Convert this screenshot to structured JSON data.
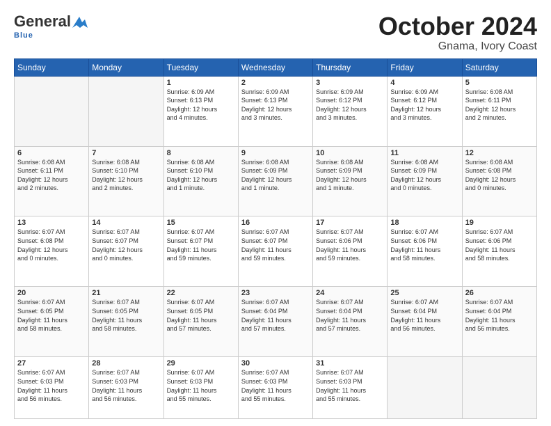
{
  "header": {
    "logo_line1": "General",
    "logo_line2": "Blue",
    "title": "October 2024",
    "subtitle": "Gnama, Ivory Coast"
  },
  "weekdays": [
    "Sunday",
    "Monday",
    "Tuesday",
    "Wednesday",
    "Thursday",
    "Friday",
    "Saturday"
  ],
  "weeks": [
    [
      {
        "day": "",
        "info": ""
      },
      {
        "day": "",
        "info": ""
      },
      {
        "day": "1",
        "info": "Sunrise: 6:09 AM\nSunset: 6:13 PM\nDaylight: 12 hours\nand 4 minutes."
      },
      {
        "day": "2",
        "info": "Sunrise: 6:09 AM\nSunset: 6:13 PM\nDaylight: 12 hours\nand 3 minutes."
      },
      {
        "day": "3",
        "info": "Sunrise: 6:09 AM\nSunset: 6:12 PM\nDaylight: 12 hours\nand 3 minutes."
      },
      {
        "day": "4",
        "info": "Sunrise: 6:09 AM\nSunset: 6:12 PM\nDaylight: 12 hours\nand 3 minutes."
      },
      {
        "day": "5",
        "info": "Sunrise: 6:08 AM\nSunset: 6:11 PM\nDaylight: 12 hours\nand 2 minutes."
      }
    ],
    [
      {
        "day": "6",
        "info": "Sunrise: 6:08 AM\nSunset: 6:11 PM\nDaylight: 12 hours\nand 2 minutes."
      },
      {
        "day": "7",
        "info": "Sunrise: 6:08 AM\nSunset: 6:10 PM\nDaylight: 12 hours\nand 2 minutes."
      },
      {
        "day": "8",
        "info": "Sunrise: 6:08 AM\nSunset: 6:10 PM\nDaylight: 12 hours\nand 1 minute."
      },
      {
        "day": "9",
        "info": "Sunrise: 6:08 AM\nSunset: 6:09 PM\nDaylight: 12 hours\nand 1 minute."
      },
      {
        "day": "10",
        "info": "Sunrise: 6:08 AM\nSunset: 6:09 PM\nDaylight: 12 hours\nand 1 minute."
      },
      {
        "day": "11",
        "info": "Sunrise: 6:08 AM\nSunset: 6:09 PM\nDaylight: 12 hours\nand 0 minutes."
      },
      {
        "day": "12",
        "info": "Sunrise: 6:08 AM\nSunset: 6:08 PM\nDaylight: 12 hours\nand 0 minutes."
      }
    ],
    [
      {
        "day": "13",
        "info": "Sunrise: 6:07 AM\nSunset: 6:08 PM\nDaylight: 12 hours\nand 0 minutes."
      },
      {
        "day": "14",
        "info": "Sunrise: 6:07 AM\nSunset: 6:07 PM\nDaylight: 12 hours\nand 0 minutes."
      },
      {
        "day": "15",
        "info": "Sunrise: 6:07 AM\nSunset: 6:07 PM\nDaylight: 11 hours\nand 59 minutes."
      },
      {
        "day": "16",
        "info": "Sunrise: 6:07 AM\nSunset: 6:07 PM\nDaylight: 11 hours\nand 59 minutes."
      },
      {
        "day": "17",
        "info": "Sunrise: 6:07 AM\nSunset: 6:06 PM\nDaylight: 11 hours\nand 59 minutes."
      },
      {
        "day": "18",
        "info": "Sunrise: 6:07 AM\nSunset: 6:06 PM\nDaylight: 11 hours\nand 58 minutes."
      },
      {
        "day": "19",
        "info": "Sunrise: 6:07 AM\nSunset: 6:06 PM\nDaylight: 11 hours\nand 58 minutes."
      }
    ],
    [
      {
        "day": "20",
        "info": "Sunrise: 6:07 AM\nSunset: 6:05 PM\nDaylight: 11 hours\nand 58 minutes."
      },
      {
        "day": "21",
        "info": "Sunrise: 6:07 AM\nSunset: 6:05 PM\nDaylight: 11 hours\nand 58 minutes."
      },
      {
        "day": "22",
        "info": "Sunrise: 6:07 AM\nSunset: 6:05 PM\nDaylight: 11 hours\nand 57 minutes."
      },
      {
        "day": "23",
        "info": "Sunrise: 6:07 AM\nSunset: 6:04 PM\nDaylight: 11 hours\nand 57 minutes."
      },
      {
        "day": "24",
        "info": "Sunrise: 6:07 AM\nSunset: 6:04 PM\nDaylight: 11 hours\nand 57 minutes."
      },
      {
        "day": "25",
        "info": "Sunrise: 6:07 AM\nSunset: 6:04 PM\nDaylight: 11 hours\nand 56 minutes."
      },
      {
        "day": "26",
        "info": "Sunrise: 6:07 AM\nSunset: 6:04 PM\nDaylight: 11 hours\nand 56 minutes."
      }
    ],
    [
      {
        "day": "27",
        "info": "Sunrise: 6:07 AM\nSunset: 6:03 PM\nDaylight: 11 hours\nand 56 minutes."
      },
      {
        "day": "28",
        "info": "Sunrise: 6:07 AM\nSunset: 6:03 PM\nDaylight: 11 hours\nand 56 minutes."
      },
      {
        "day": "29",
        "info": "Sunrise: 6:07 AM\nSunset: 6:03 PM\nDaylight: 11 hours\nand 55 minutes."
      },
      {
        "day": "30",
        "info": "Sunrise: 6:07 AM\nSunset: 6:03 PM\nDaylight: 11 hours\nand 55 minutes."
      },
      {
        "day": "31",
        "info": "Sunrise: 6:07 AM\nSunset: 6:03 PM\nDaylight: 11 hours\nand 55 minutes."
      },
      {
        "day": "",
        "info": ""
      },
      {
        "day": "",
        "info": ""
      }
    ]
  ]
}
